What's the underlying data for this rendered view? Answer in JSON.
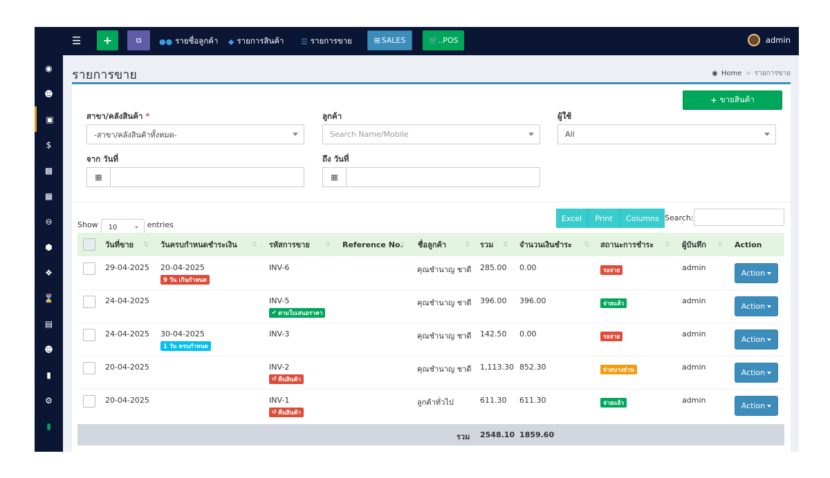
{
  "topbar": {
    "nav_customers": "รายชื่อลูกค้า",
    "nav_products": "รายการสินค้า",
    "nav_sales": "รายการขาย",
    "sales_btn": "SALES",
    "pos_btn": "..POS",
    "user_name": "admin"
  },
  "page": {
    "title": "รายการขาย",
    "breadcrumb_home": "Home",
    "breadcrumb_current": "รายการขาย",
    "sell_button": "ขายสินค้า"
  },
  "filters": {
    "branch_label": "สาขา/คลังสินค้า",
    "branch_value": "-สาขา/คลังสินค้าทั้งหมด-",
    "customer_label": "ลูกค้า",
    "customer_placeholder": "Search Name/Mobile",
    "user_label": "ผู้ใช้",
    "user_value": "All",
    "from_label": "จาก วันที่",
    "to_label": "ถึง วันที่"
  },
  "datatable": {
    "show_label": "Show",
    "length_value": "10",
    "entries_label": "entries",
    "btn_excel": "Excel",
    "btn_print": "Print",
    "btn_columns": "Columns",
    "search_label": "Search:"
  },
  "table": {
    "headers": [
      "วันที่ขาย",
      "วันครบกำหนดชำระเงิน",
      "รหัสการขาย",
      "Reference No.",
      "ชื่อลูกค้า",
      "รวม",
      "จำนวนเงินชำระ",
      "สถานะการชำระ",
      "ผู้บันทึก",
      "Action"
    ],
    "rows": [
      {
        "date": "29-04-2025",
        "due": "20-04-2025",
        "due_badge": "9 วัน เกินกำหนด",
        "code": "INV-6",
        "code_badge": "",
        "ref": "",
        "customer": "คุณชำนาญ ชาดี",
        "total": "285.00",
        "paid": "0.00",
        "status": "รอจ่าย",
        "user": "admin",
        "action": "Action"
      },
      {
        "date": "24-04-2025",
        "due": "",
        "due_badge": "",
        "code": "INV-5",
        "code_badge": "ตามใบเสนอราคา",
        "ref": "",
        "customer": "คุณชำนาญ ชาดี",
        "total": "396.00",
        "paid": "396.00",
        "status": "จ่ายแล้ว",
        "user": "admin",
        "action": "Action"
      },
      {
        "date": "24-04-2025",
        "due": "30-04-2025",
        "due_badge": "1 วัน ครบกำหนด",
        "code": "INV-3",
        "code_badge": "",
        "ref": "",
        "customer": "คุณชำนาญ ชาดี",
        "total": "142.50",
        "paid": "0.00",
        "status": "รอจ่าย",
        "user": "admin",
        "action": "Action"
      },
      {
        "date": "20-04-2025",
        "due": "",
        "due_badge": "",
        "code": "INV-2",
        "code_badge": "คืนสินค้า",
        "ref": "",
        "customer": "คุณชำนาญ ชาดี",
        "total": "1,113.30",
        "paid": "852.30",
        "status": "จ่ายบางส่วน",
        "user": "admin",
        "action": "Action"
      },
      {
        "date": "20-04-2025",
        "due": "",
        "due_badge": "",
        "code": "INV-1",
        "code_badge": "คืนสินค้า",
        "ref": "",
        "customer": "ลูกค้าทั่วไป",
        "total": "611.30",
        "paid": "611.30",
        "status": "จ่ายแล้ว",
        "user": "admin",
        "action": "Action"
      }
    ],
    "footer": {
      "label": "รวม",
      "total": "2548.10",
      "paid": "1859.60"
    }
  },
  "colors": {
    "navy": "#0b1634",
    "green": "#00a65a",
    "red": "#dd4b39",
    "cyan": "#00c0ef",
    "orange": "#f39c12",
    "teal": "#39cccc",
    "blue": "#3c8dbc"
  }
}
